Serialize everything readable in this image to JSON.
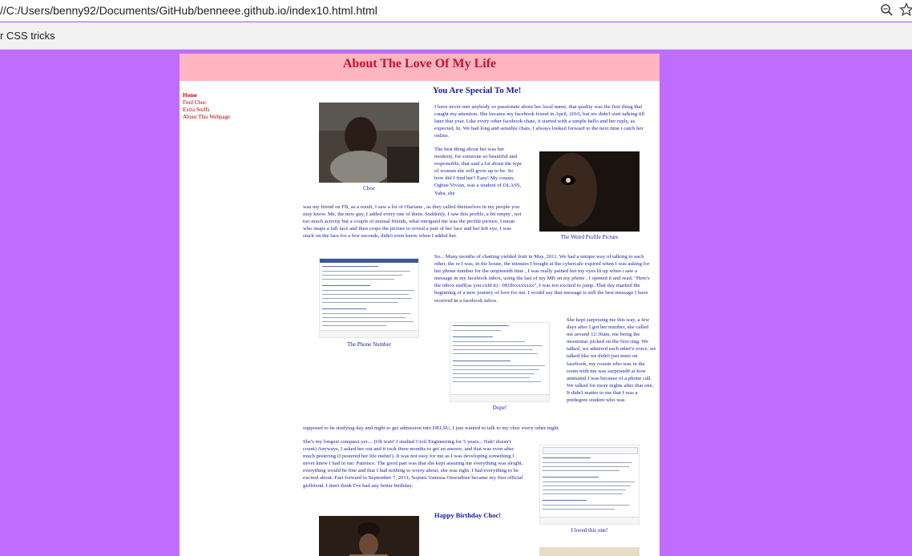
{
  "browser": {
    "url": "//C:/Users/benny92/Documents/GitHub/benneee.github.io/index10.html.html",
    "bookmark": "r CSS tricks",
    "icons": [
      "zoom-icon",
      "star-icon"
    ]
  },
  "colors": {
    "background": "#c06cff",
    "header": "#ffb6c1",
    "title": "#c8102e",
    "text": "#1a1aa0",
    "nav": "#b00000"
  },
  "page": {
    "title": "About The Love Of My Life",
    "nav": [
      "Home",
      "Find Choc",
      "Extra Stuffs",
      "About This Webpage"
    ],
    "special_heading": "You Are Special To Me!",
    "birthday_heading": "Happy Birthday Choc!",
    "captions": {
      "choc": "Choc",
      "weird": "The Weird Profile Picture",
      "phone": "The Phone Number",
      "dope": "Dope!",
      "loved": "I loved this one!"
    },
    "p1": "I have never met anybody so passionate about her local name, that quality was the first thing that caught my attention. She became my facebook friend in April, 2010, but we didn't start talking till later that year. Like every other facebook chats, it started with a simple hello and her reply, as expected, hi. We had long and sensible chats, I always looked forward to the next time i catch her online.",
    "p2a": "The best thing about her was her modesty, for someone so beautiful and responsible, that said a lot about the type of woman she will grow up to be. So how did I find her? Easy! My cousin, Ogbue Vivian, was a student of OLASS, Yaba, she",
    "p2b": "was my friend on FB, as a result, I saw a lot of Olarians , as they called themselves in my people you may know. Me, the new guy, I added every one of them. Suddenly, I saw this profile, a bit empty , not too much activity but a couple of mutual friends, what intrigued me was the profile picture, I mean who snaps a full face and then crops the picture to reveal a part of her face and her left eye, I was stuck on the face for a few seconds, didn't even know when I added her.",
    "p3": "So... Many months of chatting yielded fruit in May, 2011. We had a unique way of talking to each other, the re I was, in the house, the minutes I bought at the cybercafe expired when I was asking for her phone number for the umpteenth time , I was really pained but my eyes lit up when i saw a message in my facebook inbox, using the last of my MB on my phone , I opened it and read; \"Here's the inbox stuff(as you culd it) : 0818xxxxxxxx\", I was too excited to jump. That day marked the beginning of a new journey of love for me. I would say that message is still the best message I have received in a facebook inbox.",
    "p4a": "She kept surprising me this way, a few days after I got her number, she called me around 12:30am, me being the insomniac picked on the first ring. We talked, we admired each other's voice, we talked like we didn't just meet on facebook, my cousin who was in the room with me was surprised# at how animated I was because of a phone call. We talked for more nights after that one, It didn't matter to me that I was a predegree student who was",
    "p4b": "supposed to be studying day and night to get admission into DELSU, I just wanted to talk to my choc every other night.",
    "p5": "She's my longest conquest yet.... (Oh wait! I studied Civil Engineering for 5 years... Nah! doesn't count) Anyways, I asked her out and it took three months to get an answer, and that was even after much pestering (I pestered her life mehn!). It was not easy for me as I was developing something I never knew I had in me: Patience. The good part was that she kept assuring me everything was alright, everything would be fine and that I had nothing to worry about, she was right. I had everything to be excited about. Fast forward to September 7, 2011; Sopuru Vanessa Onwudiwe became my first official girlfriend. I don't think I've had any better birthday."
  }
}
